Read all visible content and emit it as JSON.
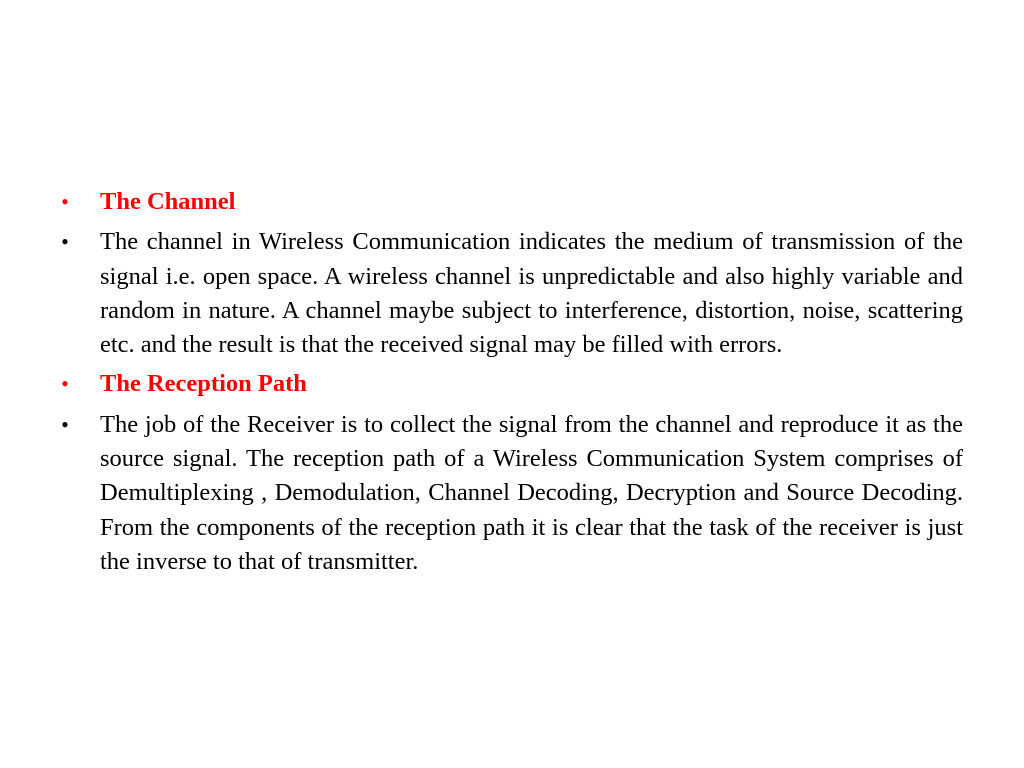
{
  "slide": {
    "colors": {
      "heading": "#ff0000",
      "body": "#000000",
      "background": "#ffffff"
    },
    "bullet_glyph": "•",
    "items": [
      {
        "type": "heading",
        "text": "The Channel"
      },
      {
        "type": "body",
        "text": "The channel in Wireless Communication indicates the medium of transmission of the signal i.e. open space. A wireless channel is unpredictable and also highly variable and random in nature. A channel maybe subject to interference, distortion, noise, scattering etc. and the result is that the received signal may be filled with errors."
      },
      {
        "type": "heading",
        "text": "The Reception Path"
      },
      {
        "type": "body",
        "text": "The job of the Receiver is to collect the signal from the channel and reproduce it as the source signal. The reception path of a Wireless Communication System comprises of Demultiplexing , Demodulation, Channel Decoding, Decryption and Source Decoding. From the components of the reception path it is clear that the task of the receiver is just the inverse to that of transmitter."
      }
    ]
  }
}
